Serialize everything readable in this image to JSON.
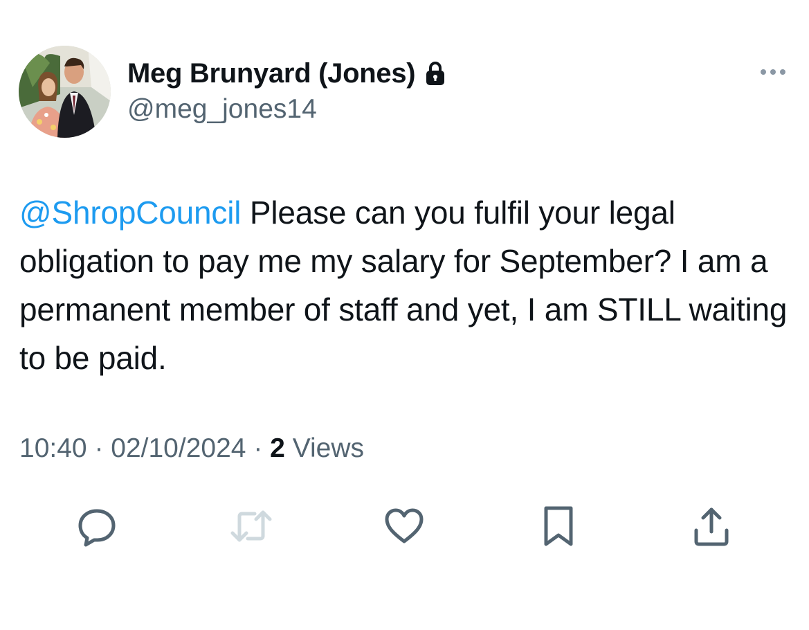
{
  "tweet": {
    "author": {
      "display_name": "Meg Brunyard (Jones)",
      "handle": "@meg_jones14",
      "protected": true
    },
    "text": {
      "mention": "@ShropCouncil",
      "body": " Please can you fulfil your legal obligation to pay me my salary for September? I am a permanent member of staff and yet, I am STILL waiting to be paid."
    },
    "meta": {
      "time": "10:40",
      "separator_1": " · ",
      "date": "02/10/2024",
      "separator_2": " · ",
      "views_count": "2",
      "views_label": " Views"
    },
    "actions": [
      {
        "name": "reply",
        "icon": "reply-icon"
      },
      {
        "name": "retweet",
        "icon": "retweet-icon",
        "disabled": true
      },
      {
        "name": "like",
        "icon": "heart-icon"
      },
      {
        "name": "bookmark",
        "icon": "bookmark-icon"
      },
      {
        "name": "share",
        "icon": "share-icon"
      }
    ],
    "colors": {
      "text": "#0f1419",
      "secondary": "#536471",
      "link": "#1d9bf0",
      "disabled_icon": "#cfd9de"
    }
  }
}
